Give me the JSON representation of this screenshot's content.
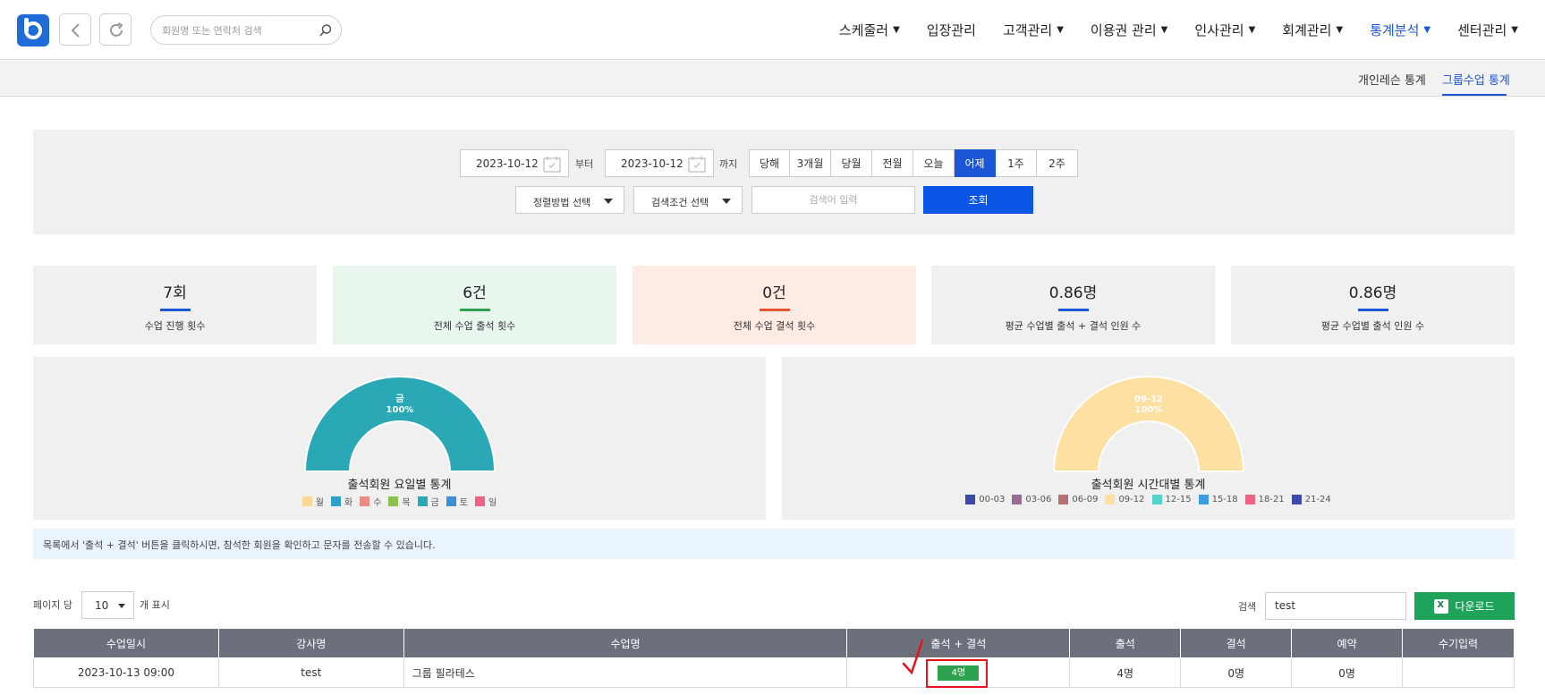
{
  "header": {
    "search_placeholder": "회원명 또는 연락처 검색",
    "menu": [
      {
        "label": "스케줄러",
        "has_dropdown": true
      },
      {
        "label": "입장관리",
        "has_dropdown": false
      },
      {
        "label": "고객관리",
        "has_dropdown": true
      },
      {
        "label": "이용권 관리",
        "has_dropdown": true
      },
      {
        "label": "인사관리",
        "has_dropdown": true
      },
      {
        "label": "회계관리",
        "has_dropdown": true
      },
      {
        "label": "통계분석",
        "has_dropdown": true,
        "active": true
      },
      {
        "label": "센터관리",
        "has_dropdown": true
      }
    ],
    "chevron": "⌄"
  },
  "subnav": {
    "tabs": [
      "개인레슨 통계",
      "그룹수업 통계"
    ],
    "active": "그룹수업 통계"
  },
  "filter": {
    "start_date": "2023-10-12",
    "from_label": "부터",
    "end_date": "2023-10-12",
    "to_label": "까지",
    "periods": [
      "당해",
      "3개월",
      "당월",
      "전월",
      "오늘",
      "어제",
      "1주",
      "2주"
    ],
    "active_period": "어제",
    "sort_select": "정렬방법 선택",
    "cond_select": "검색조건 선택",
    "keyword_placeholder": "검색어 입력",
    "submit": "조회"
  },
  "stats": [
    {
      "value": "7회",
      "label": "수업 진행 횟수",
      "accent": "#1a56d6",
      "bg": "#f0f0f0"
    },
    {
      "value": "6건",
      "label": "전체 수업 출석 횟수",
      "accent": "#2ea24f",
      "bg": "#e9f6ee"
    },
    {
      "value": "0건",
      "label": "전체 수업 결석 횟수",
      "accent": "#e5532c",
      "bg": "#fdebe4"
    },
    {
      "value": "0.86명",
      "label": "평균 수업별 출석 + 결석 인원 수",
      "accent": "#1a56d6",
      "bg": "#f0f0f0"
    },
    {
      "value": "0.86명",
      "label": "평균 수업별 출석 인원 수",
      "accent": "#1a56d6",
      "bg": "#f0f0f0"
    }
  ],
  "charts": {
    "weekday": {
      "title": "출석회원 요일별 통계",
      "label": "금",
      "percent": "100%",
      "color": "#2aa8b5",
      "legend": [
        {
          "name": "월",
          "color": "#fbd993"
        },
        {
          "name": "화",
          "color": "#2ca0c9"
        },
        {
          "name": "수",
          "color": "#f08a84"
        },
        {
          "name": "목",
          "color": "#8cc151"
        },
        {
          "name": "금",
          "color": "#2aa8b5"
        },
        {
          "name": "토",
          "color": "#3b8fd6"
        },
        {
          "name": "일",
          "color": "#ee6384"
        }
      ]
    },
    "time": {
      "title": "출석회원 시간대별 통계",
      "label": "09-12",
      "percent": "100%",
      "color": "#fde0a2",
      "legend": [
        {
          "name": "00-03",
          "color": "#3b4aa8"
        },
        {
          "name": "03-06",
          "color": "#9a6a93"
        },
        {
          "name": "06-09",
          "color": "#b77071"
        },
        {
          "name": "09-12",
          "color": "#fde0a2"
        },
        {
          "name": "12-15",
          "color": "#53d4cf"
        },
        {
          "name": "15-18",
          "color": "#3a9ee0"
        },
        {
          "name": "18-21",
          "color": "#ee6384"
        },
        {
          "name": "21-24",
          "color": "#3b4aa8"
        }
      ]
    }
  },
  "chart_data": [
    {
      "type": "pie",
      "title": "출석회원 요일별 통계",
      "categories": [
        "월",
        "화",
        "수",
        "목",
        "금",
        "토",
        "일"
      ],
      "values": [
        0,
        0,
        0,
        0,
        100,
        0,
        0
      ]
    },
    {
      "type": "pie",
      "title": "출석회원 시간대별 통계",
      "categories": [
        "00-03",
        "03-06",
        "06-09",
        "09-12",
        "12-15",
        "15-18",
        "18-21",
        "21-24"
      ],
      "values": [
        0,
        0,
        0,
        100,
        0,
        0,
        0,
        0
      ]
    }
  ],
  "notice": "목록에서 '출석 + 결석' 버튼을 클릭하시면, 참석한 회원을 확인하고 문자를 전송할 수 있습니다.",
  "table_controls": {
    "per_page_label": "페이지 당",
    "per_page_value": "10",
    "per_page_suffix": "개 표시",
    "search_label": "검색",
    "search_value": "test",
    "download": "다운로드",
    "excel_glyph": "X"
  },
  "table": {
    "columns": [
      "수업일시",
      "강사명",
      "수업명",
      "출석 + 결석",
      "출석",
      "결석",
      "예약",
      "수기입력"
    ],
    "rows": [
      {
        "datetime": "2023-10-13 09:00",
        "instructor": "test",
        "class_name": "그룹 필라테스",
        "total": "4명",
        "attend": "4명",
        "absent": "0명",
        "reserve": "0명",
        "manual": ""
      }
    ]
  }
}
